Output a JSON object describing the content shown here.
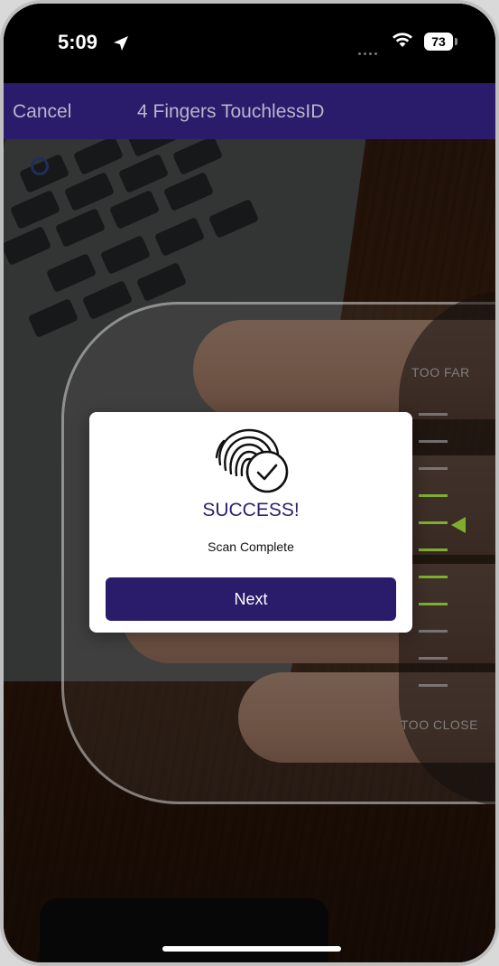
{
  "status_bar": {
    "time": "5:09",
    "battery": "73",
    "icons": [
      "location-arrow-icon",
      "signal-dots-icon",
      "wifi-icon",
      "battery-icon"
    ]
  },
  "nav": {
    "cancel_label": "Cancel",
    "title": "4 Fingers TouchlessID"
  },
  "gauge": {
    "top_label": "TOO FAR",
    "bottom_label": "TOO CLOSE",
    "tick_count": 11,
    "in_range_ticks": [
      3,
      4,
      5,
      6,
      7
    ],
    "pointer_tick": 4,
    "colors": {
      "in_range": "#7fae2e",
      "out_of_range": "#8c8c8c"
    }
  },
  "dialog": {
    "icon": "fingerprint-check-icon",
    "title": "SUCCESS!",
    "subtitle": "Scan Complete",
    "button_label": "Next"
  },
  "colors": {
    "brand": "#2a1b6b",
    "title_text": "#2e2170"
  }
}
